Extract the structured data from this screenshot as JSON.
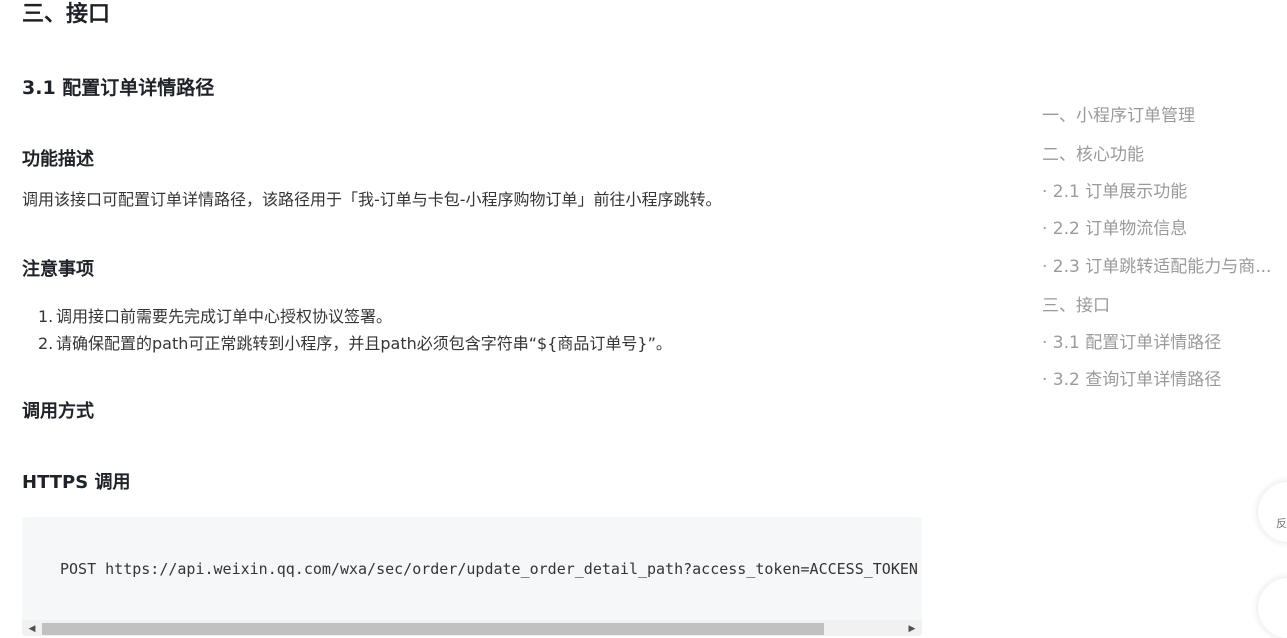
{
  "section_title": "三、接口",
  "subsection_title": "3.1 配置订单详情路径",
  "description": {
    "heading": "功能描述",
    "text": "调用该接口可配置订单详情路径，该路径用于「我-订单与卡包-小程序购物订单」前往小程序跳转。"
  },
  "notes": {
    "heading": "注意事项",
    "items": [
      {
        "num": "1.",
        "text": "调用接口前需要先完成订单中心授权协议签署。"
      },
      {
        "num": "2.",
        "text": "请确保配置的path可正常跳转到小程序，并且path必须包含字符串“${商品订单号}”。"
      }
    ]
  },
  "call_method": {
    "heading": "调用方式"
  },
  "https_call": {
    "heading": "HTTPS 调用",
    "code": "POST https://api.weixin.qq.com/wxa/sec/order/update_order_detail_path?access_token=ACCESS_TOKEN"
  },
  "toc": [
    "一、小程序订单管理",
    "二、核心功能",
    "· 2.1 订单展示功能",
    "· 2.2 订单物流信息",
    "· 2.3 订单跳转适配能力与商...",
    "三、接口",
    "· 3.1 配置订单详情路径",
    "· 3.2 查询订单详情路径"
  ],
  "floating": {
    "feedback_label": "反"
  }
}
